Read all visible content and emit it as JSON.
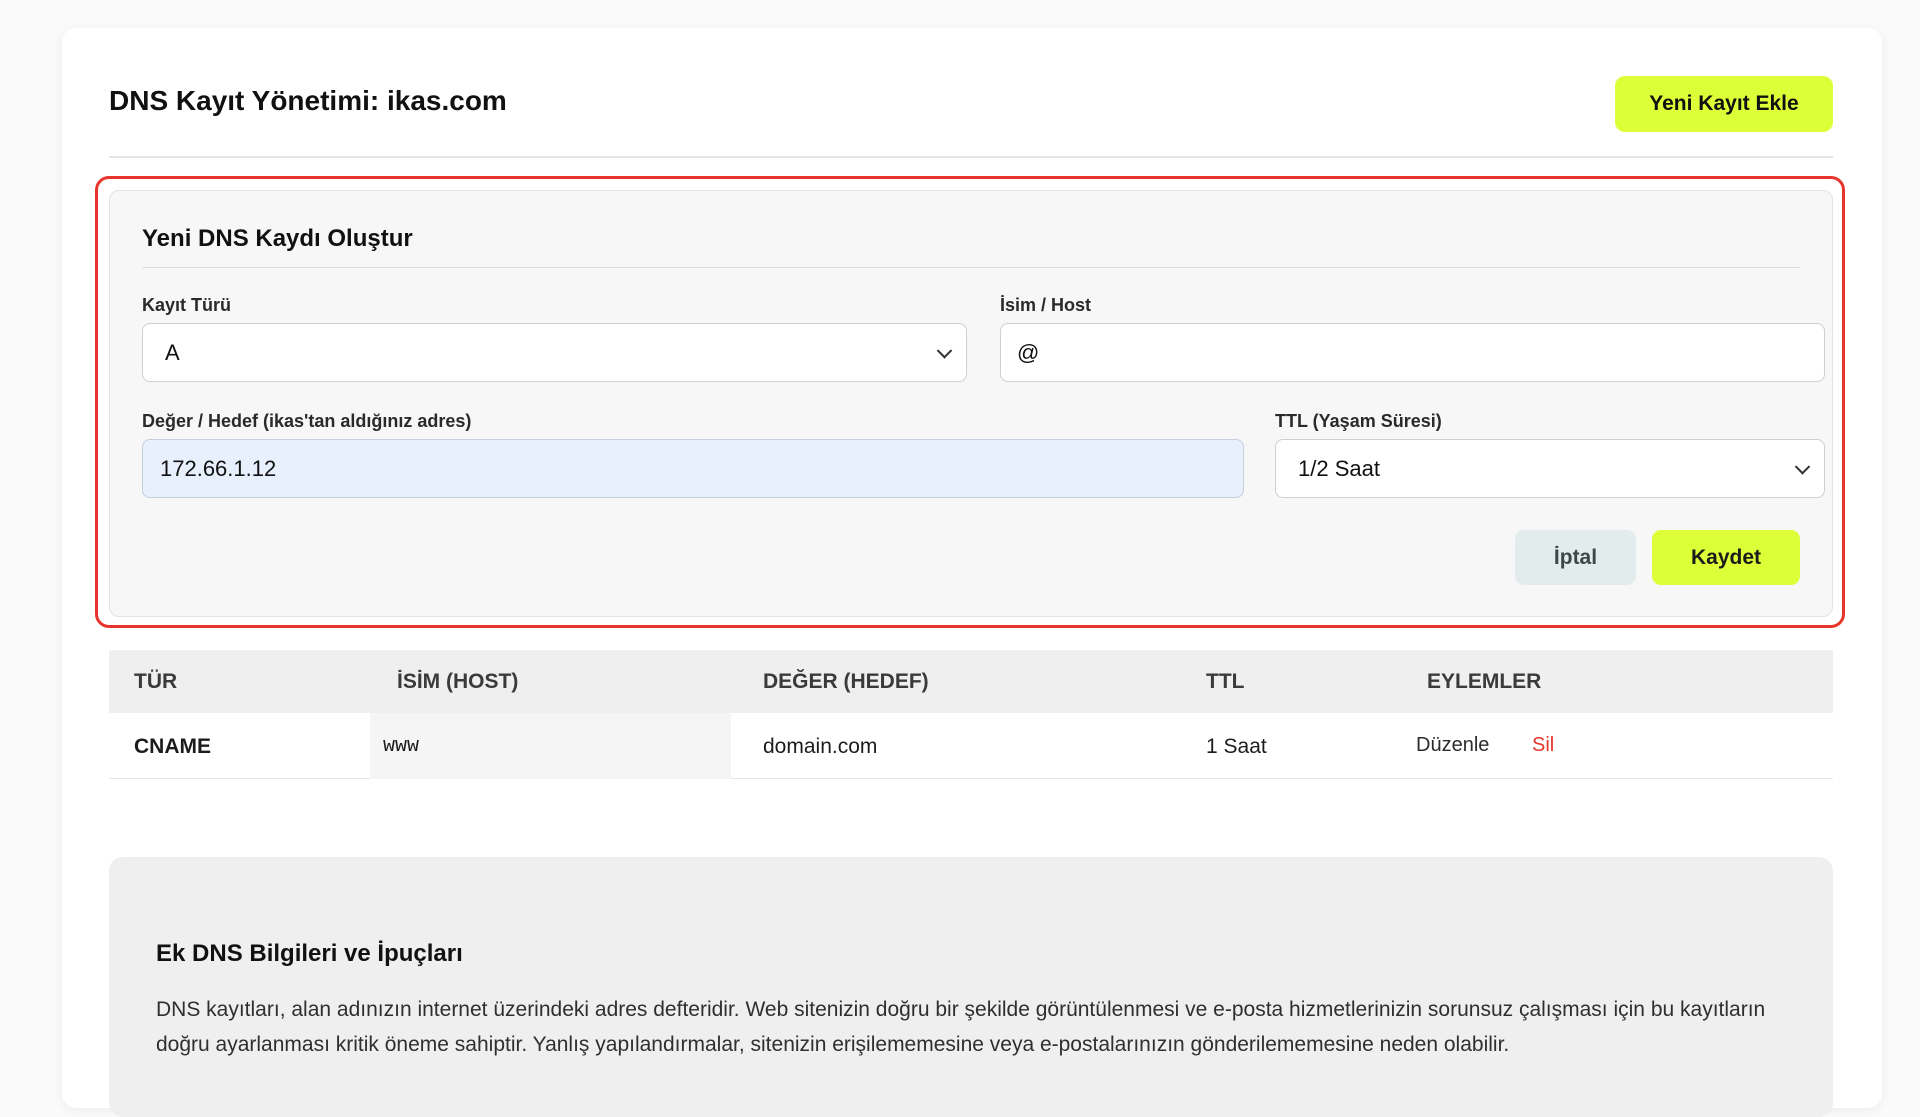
{
  "header": {
    "title": "DNS Kayıt Yönetimi: ikas.com",
    "add_button": "Yeni Kayıt Ekle"
  },
  "form": {
    "title": "Yeni DNS Kaydı Oluştur",
    "record_type_label": "Kayıt Türü",
    "record_type_value": "A",
    "host_label": "İsim / Host",
    "host_value": "@",
    "value_label": "Değer / Hedef (ikas'tan aldığınız adres)",
    "value_value": "172.66.1.12",
    "ttl_label": "TTL (Yaşam Süresi)",
    "ttl_value": "1/2 Saat",
    "cancel_button": "İptal",
    "save_button": "Kaydet"
  },
  "table": {
    "headers": [
      "TÜR",
      "İSİM (HOST)",
      "DEĞER (HEDEF)",
      "TTL",
      "EYLEMLER"
    ],
    "rows": [
      {
        "type": "CNAME",
        "host": "www",
        "value": "domain.com",
        "ttl": "1 Saat",
        "edit": "Düzenle",
        "delete": "Sil"
      }
    ]
  },
  "info": {
    "title": "Ek DNS Bilgileri ve İpuçları",
    "text": "DNS kayıtları, alan adınızın internet üzerindeki adres defteridir. Web sitenizin doğru bir şekilde görüntülenmesi ve e-posta hizmetlerinizin sorunsuz çalışması için bu kayıtların doğru ayarlanması kritik öneme sahiptir. Yanlış yapılandırmalar, sitenizin erişilememesine veya e-postalarınızın gönderilememesine neden olabilir."
  },
  "colors": {
    "accent": "#dcff38",
    "highlight_border": "#e8352b",
    "delete_text": "#e8352b"
  }
}
